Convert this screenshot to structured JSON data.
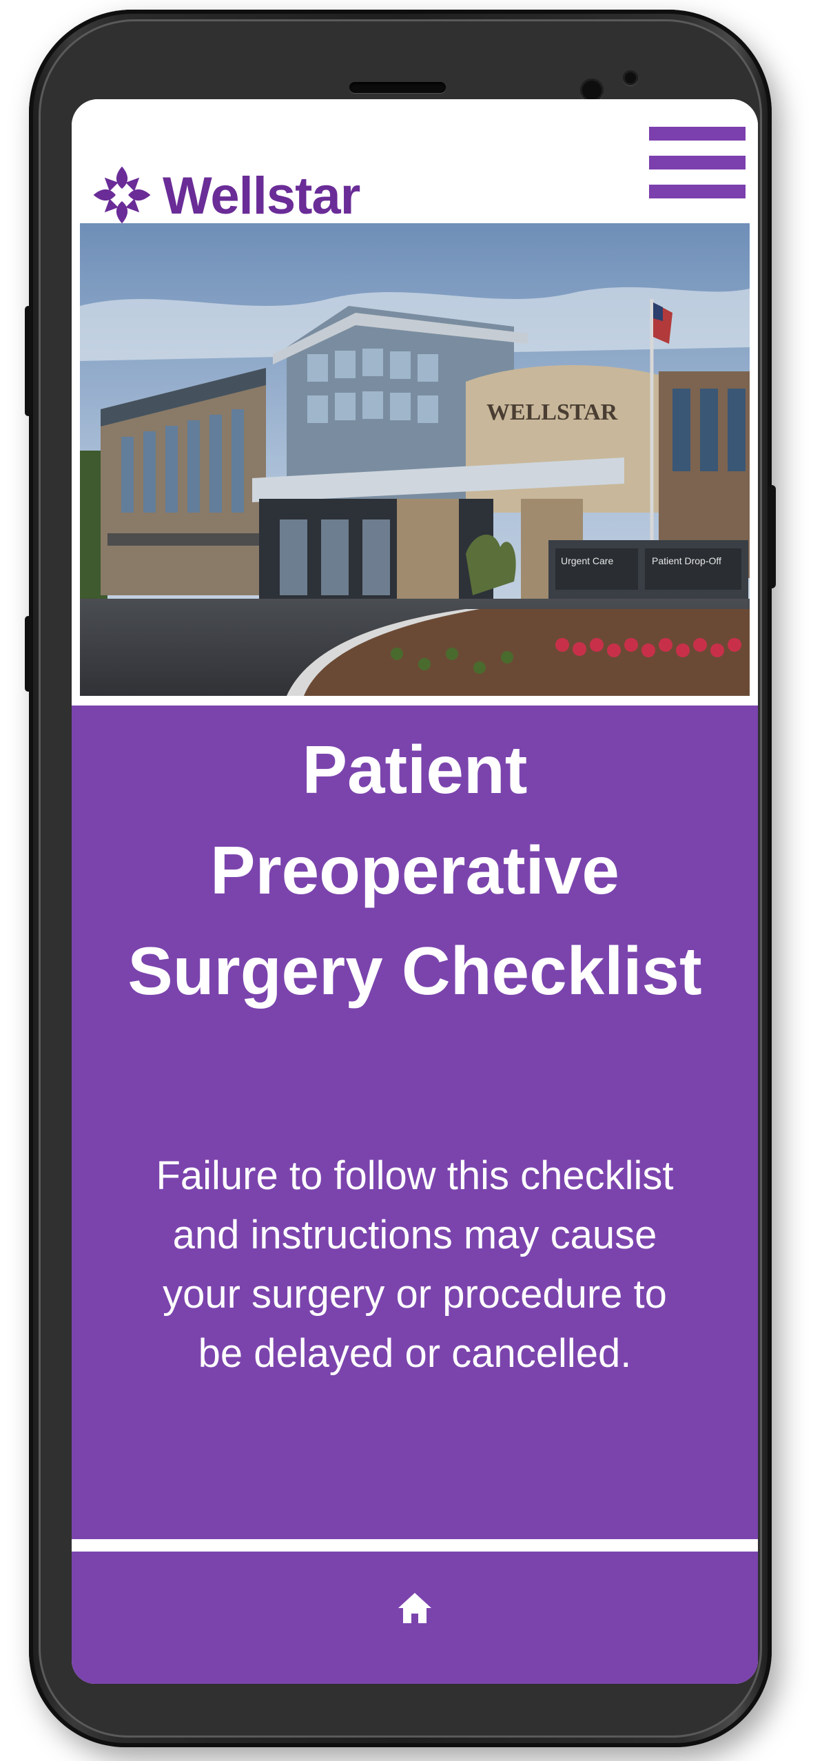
{
  "app": {
    "brand": "Wellstar",
    "colors": {
      "brand_purple": "#7b44ad",
      "logo_purple": "#6a2c97",
      "text_on_purple": "#ffffff"
    }
  },
  "header": {
    "logo_text": "Wellstar",
    "logo_icon": "wellstar-logo-icon",
    "menu_icon": "hamburger-menu-icon"
  },
  "hero": {
    "image_subject": "hospital-building-photo"
  },
  "banner": {
    "title_lines": [
      "Patient",
      "Preoperative",
      "Surgery Checklist"
    ],
    "subtitle_lines": [
      "Failure to follow this checklist",
      "and instructions may cause",
      "your surgery or procedure to",
      "be delayed or cancelled."
    ]
  },
  "footer": {
    "home_icon": "home-icon"
  }
}
